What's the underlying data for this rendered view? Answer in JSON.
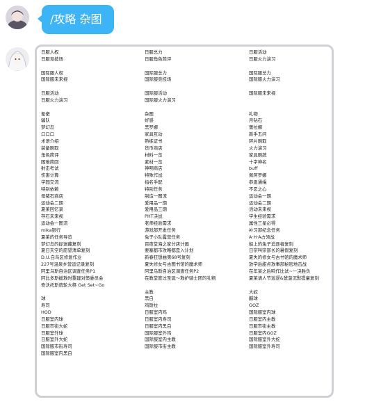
{
  "message": {
    "text": "/攻略 杂图"
  },
  "columns": [
    [
      "日服人权",
      "日服竞技场",
      "",
      "国际服人权",
      "国际服未来视",
      "",
      "日服活动",
      "日服火力演习",
      "",
      "氪佬",
      "骗队",
      "梦幻岛",
      "口口口",
      "术语介绍",
      "装备刷取",
      "角色简评",
      "困难简回",
      "射击考试",
      "伤害计算",
      "学园交流",
      "特别依赖",
      "母猪石商店",
      "运动会二期",
      "夏莱回忆录",
      "存石未来视",
      "运动会一图流",
      "mika银行",
      "夏莱的任务导览",
      "梦幻岛的捉迷藏复刻",
      "夏日天空的愿望清单复刻",
      "D.U.白鸟区修复作业",
      "227号温泉乡营运记录复刻",
      "阿里乌斯自治区调查任务P1",
      "阿比多斯援救时重建对策委员会",
      "奇沃托斯萌轮大祭 Get Set~Go",
      "",
      "球",
      "寿司",
      "HOD",
      "日服室内球",
      "日服市街大蛇",
      "日服室外球",
      "日服室外大蛇",
      "国际服市街寿司",
      "国际服室内黑白"
    ],
    [
      "日服总力",
      "日服角色简评",
      "",
      "国际服总力",
      "国际服竞技场",
      "",
      "国际服活动",
      "国际服火力演习",
      "",
      "杂图",
      "好感",
      "黑罗娜",
      "家具互动",
      "熟练证书",
      "货币商店",
      "材料一览",
      "素材一览",
      "神明商店",
      "特殊作战",
      "指名手配",
      "特别任务",
      "制造一图流",
      "爱用品一期",
      "爱用品三期",
      "PHT决战",
      "老师经验需求",
      "游戏部开发任务",
      "兔子小队露营任务",
      "百夜堂海之家分店计画",
      "要塞都市攻略都是入计划",
      "新春狂想曲第68号复刻",
      "夏失修女与古图书馆的魔术师",
      "阿里乌斯自治区调查任务P2",
      "在教堂度过圣诞～救护骑士团的礼物",
      "",
      "主教",
      "黑白",
      "鸡斯拉",
      "日服室内鸡",
      "日服室内寿司",
      "日服室内黑白",
      "国际服室外鸡",
      "国际服室内主教",
      "国际服市街主教"
    ],
    [
      "日服活动",
      "日服火力演习",
      "",
      "国际服总力",
      "国际服火力演习",
      "",
      "国际服未来视",
      "",
      "",
      "礼物",
      "月钻石",
      "薔拉娜",
      "新手五问",
      "碎片刷取",
      "火力演习",
      "家具刷蔬",
      "十字神名",
      "buff",
      "佩阿罗娜",
      "恭恩通缉",
      "不忍之心",
      "运动会一期",
      "运动会二期",
      "活动未来视",
      "学生经验需求",
      "属性三星必得",
      "补习部纪念任务",
      "A·H·A占领战",
      "船上的兔子追逐者复刻",
      "日宗叫宗部长的暑假复刻",
      "夏失的修女与古书馆的魔术师",
      "放学后甜点放事部秘密地击战",
      "在年某之后响作比试~一决胜负",
      "夏莱请人节巡逻&爸菠沉默提童复刻",
      "",
      "大蛇",
      "鼷球",
      "GOZ",
      "国际服室内球",
      "日服室内主教",
      "日服市街主教",
      "日服室内GOZ",
      "国际服室外大蛇",
      "国际服室外寿司"
    ]
  ]
}
